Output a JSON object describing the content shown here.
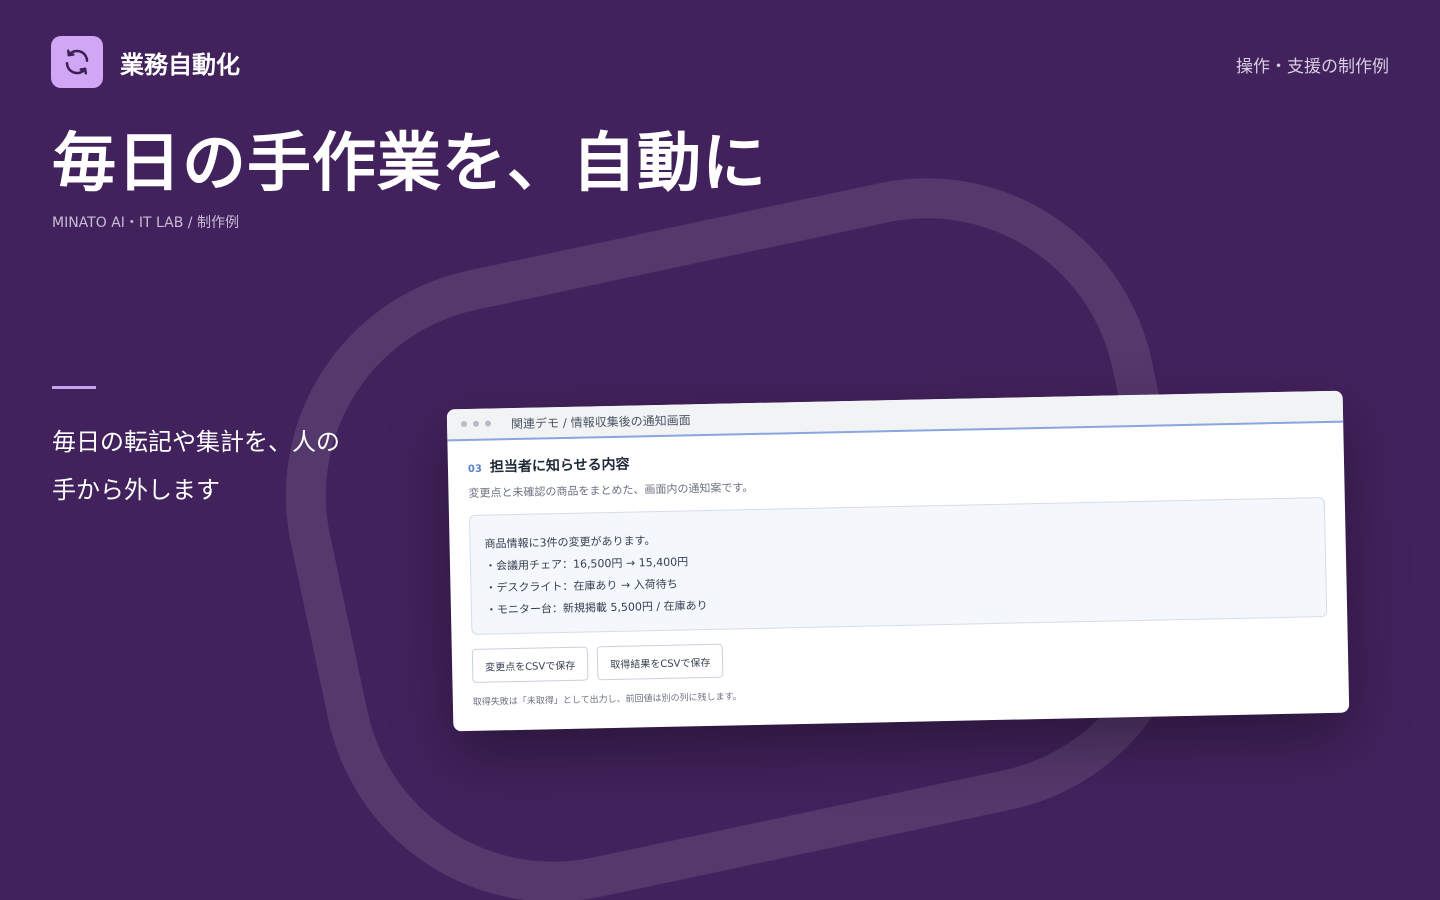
{
  "brand": {
    "name": "業務自動化"
  },
  "header": {
    "link": "操作・支援の制作例"
  },
  "hero": {
    "title": "毎日の手作業を、自動に",
    "subtitle": "MINATO AI・IT LAB / 制作例"
  },
  "lead": {
    "line1": "毎日の転記や集計を、人の",
    "line2": "手から外します"
  },
  "window": {
    "title": "関連デモ / 情報収集後の通知画面",
    "step_number": "03",
    "step_title": "担当者に知らせる内容",
    "step_description": "変更点と未確認の商品をまとめた、画面内の通知案です。",
    "notice": {
      "heading": "商品情報に3件の変更があります。",
      "items": [
        "・会議用チェア：16,500円 → 15,400円",
        "・デスクライト：在庫あり → 入荷待ち",
        "・モニター台：新規掲載 5,500円 / 在庫あり"
      ]
    },
    "buttons": {
      "save_changes": "変更点をCSVで保存",
      "save_results": "取得結果をCSVで保存"
    },
    "footnote": "取得失敗は「未取得」として出力し、前回値は別の列に残します。"
  },
  "colors": {
    "background": "#42225c",
    "brand_icon": "#d1a6f5",
    "accent": "#c8a2f0"
  },
  "icons": {
    "brand": "refresh-icon"
  }
}
